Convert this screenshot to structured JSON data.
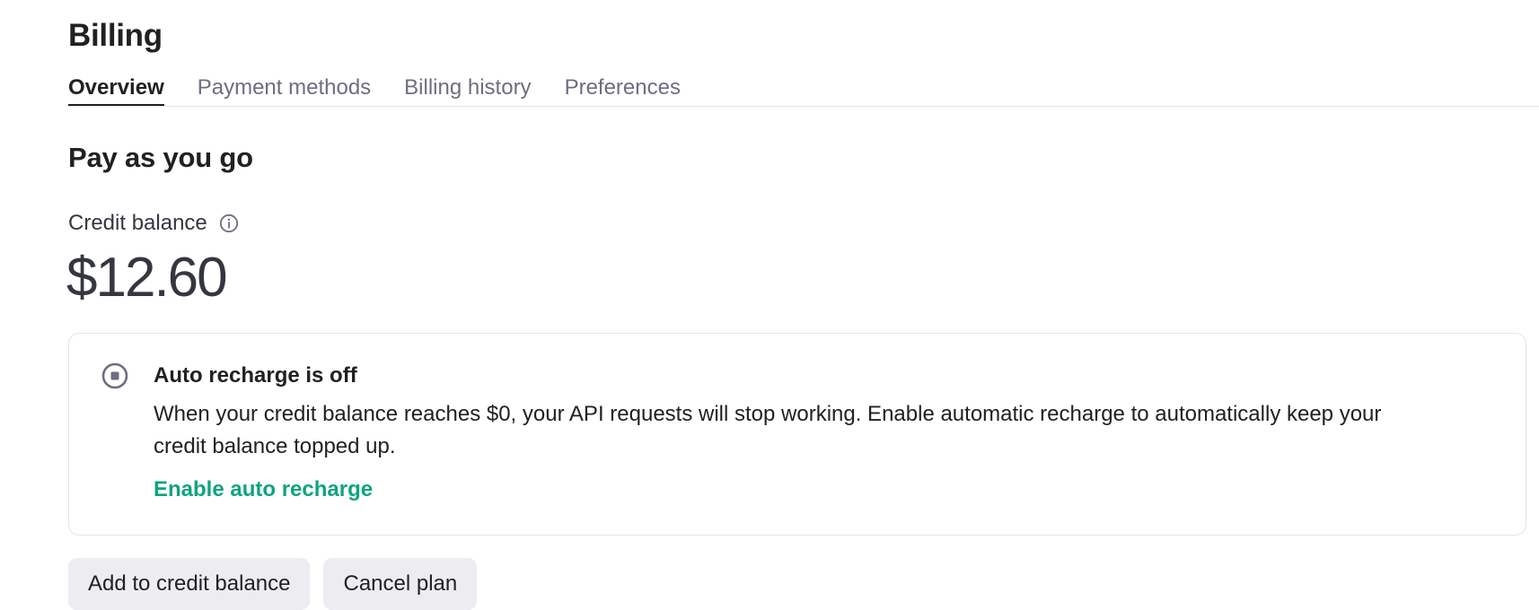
{
  "page": {
    "title": "Billing"
  },
  "tabs": [
    {
      "label": "Overview",
      "active": true
    },
    {
      "label": "Payment methods",
      "active": false
    },
    {
      "label": "Billing history",
      "active": false
    },
    {
      "label": "Preferences",
      "active": false
    }
  ],
  "plan": {
    "title": "Pay as you go",
    "credit_label": "Credit balance",
    "info_icon": "info-circle-icon",
    "balance": "$12.60"
  },
  "notice": {
    "icon": "stop-circle-icon",
    "title": "Auto recharge is off",
    "body": "When your credit balance reaches $0, your API requests will stop working. Enable automatic recharge to automatically keep your credit balance topped up.",
    "link": "Enable auto recharge"
  },
  "actions": {
    "add_credit": "Add to credit balance",
    "cancel_plan": "Cancel plan"
  },
  "colors": {
    "accent": "#10a37f",
    "text": "#202123",
    "muted": "#6e6e80",
    "button_bg": "#ececf1",
    "border": "#e5e5e5"
  }
}
